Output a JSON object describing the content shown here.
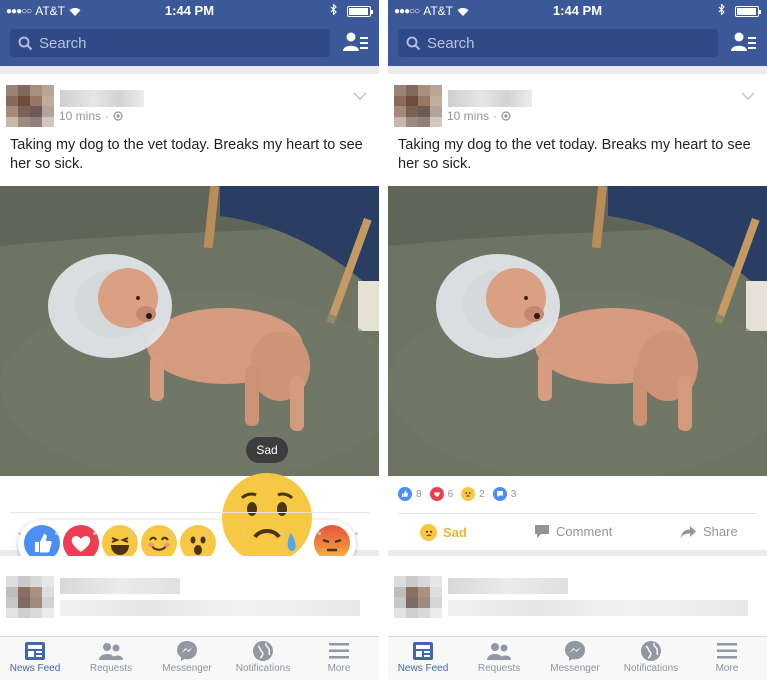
{
  "colors": {
    "brand": "#3b5998",
    "search_bg": "#2f4a87",
    "active_tab": "#4267b2",
    "sad_yellow": "#f7c843",
    "angry_red": "#e9553f"
  },
  "status": {
    "carrier": "AT&T",
    "time": "1:44 PM"
  },
  "search": {
    "placeholder": "Search"
  },
  "post": {
    "time_ago": "10 mins",
    "text": "Taking my dog to the vet today. Breaks my heart to see her so sick."
  },
  "left_panel": {
    "tooltip": "Sad",
    "reactions": [
      "like",
      "love",
      "haha",
      "yay",
      "wow",
      "sad",
      "angry"
    ]
  },
  "right_panel": {
    "reaction_counts": [
      {
        "icon": "like-icon",
        "count": "8"
      },
      {
        "icon": "love-icon",
        "count": "6"
      },
      {
        "icon": "sad-icon",
        "count": "2"
      },
      {
        "icon": "comment-icon",
        "count": "3"
      }
    ],
    "actions": {
      "sad": "Sad",
      "comment": "Comment",
      "share": "Share"
    }
  },
  "tabs": [
    {
      "label": "News Feed",
      "icon": "news-feed-icon"
    },
    {
      "label": "Requests",
      "icon": "requests-icon"
    },
    {
      "label": "Messenger",
      "icon": "messenger-icon"
    },
    {
      "label": "Notifications",
      "icon": "globe-icon"
    },
    {
      "label": "More",
      "icon": "menu-icon"
    }
  ]
}
